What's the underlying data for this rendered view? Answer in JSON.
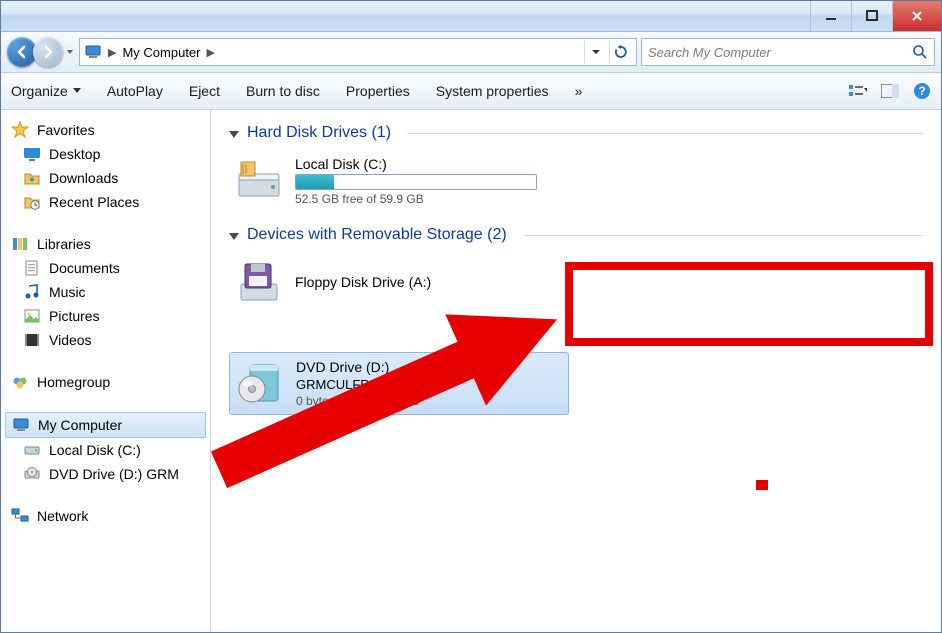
{
  "titlebar": {},
  "navbar": {
    "breadcrumb_root": "My Computer",
    "search_placeholder": "Search My Computer"
  },
  "toolbar": {
    "organize": "Organize",
    "autoplay": "AutoPlay",
    "eject": "Eject",
    "burn": "Burn to disc",
    "properties": "Properties",
    "system_properties": "System properties",
    "overflow": "»"
  },
  "sidebar": {
    "favorites": {
      "header": "Favorites",
      "items": [
        "Desktop",
        "Downloads",
        "Recent Places"
      ]
    },
    "libraries": {
      "header": "Libraries",
      "items": [
        "Documents",
        "Music",
        "Pictures",
        "Videos"
      ]
    },
    "homegroup": {
      "header": "Homegroup"
    },
    "computer": {
      "header": "My Computer",
      "items": [
        "Local Disk (C:)",
        "DVD Drive (D:) GRM"
      ]
    },
    "network": {
      "header": "Network"
    }
  },
  "main": {
    "hdd_section": {
      "title": "Hard Disk Drives (1)",
      "local_disk": {
        "title": "Local Disk (C:)",
        "free_text": "52.5 GB free of 59.9 GB",
        "used_percent": 16
      }
    },
    "removable_section": {
      "title": "Devices with Removable Storage (2)",
      "floppy": {
        "title": "Floppy Disk Drive (A:)"
      },
      "dvd": {
        "title": "DVD Drive (D:)",
        "label": "GRMCULFRER_EN_DVD",
        "free_text": "0 bytes free of 2.32 GB"
      }
    }
  }
}
